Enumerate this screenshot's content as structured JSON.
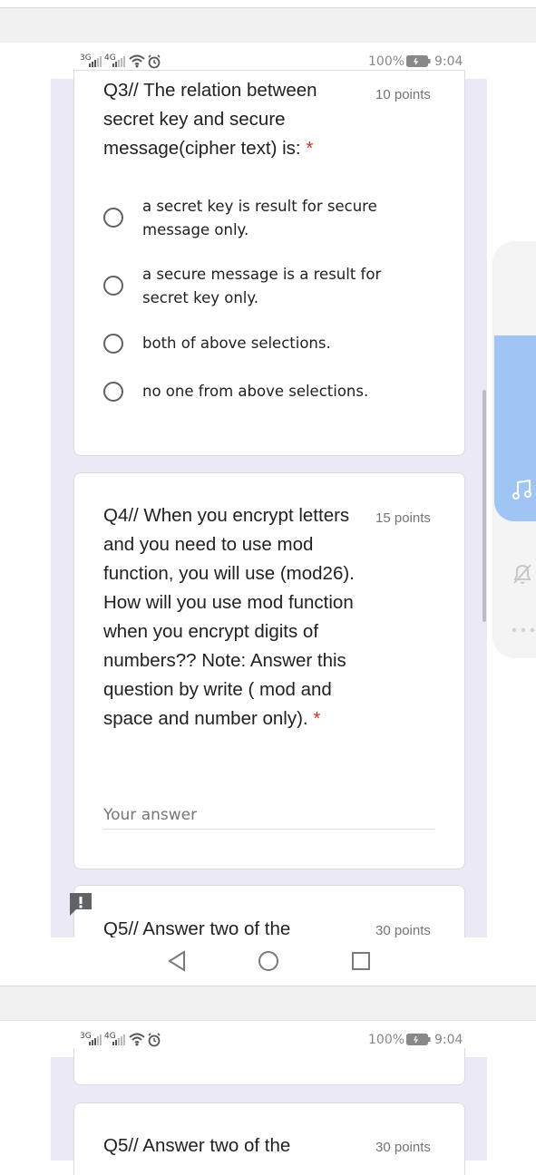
{
  "status": {
    "signal1": "3G",
    "signal2": "4G",
    "battery": "100%",
    "time": "9:04"
  },
  "q3": {
    "title": "Q3// The relation between secret key and secure message(cipher text) is:",
    "points": "10 points",
    "required": "*",
    "options": [
      "a secret key is result for secure message only.",
      "a secure message is a result for secret key only.",
      "both of above selections.",
      "no one from above selections."
    ]
  },
  "q4": {
    "title": "Q4// When you encrypt letters and you need to use mod function, you will use (mod26). How will you use mod function when you encrypt digits of numbers?? Note: Answer this question by write ( mod and space and number only).",
    "points": "15 points",
    "required": "*",
    "answer_placeholder": "Your answer"
  },
  "q5": {
    "title": "Q5// Answer two of the",
    "points": "30 points"
  },
  "feedback_icon": "exclamation-icon",
  "nav": [
    "back-icon",
    "home-icon",
    "recents-icon"
  ],
  "colors": {
    "accent_blue": "#9ec5f3",
    "required_red": "#d93025",
    "lavender": "#ece9f6"
  }
}
